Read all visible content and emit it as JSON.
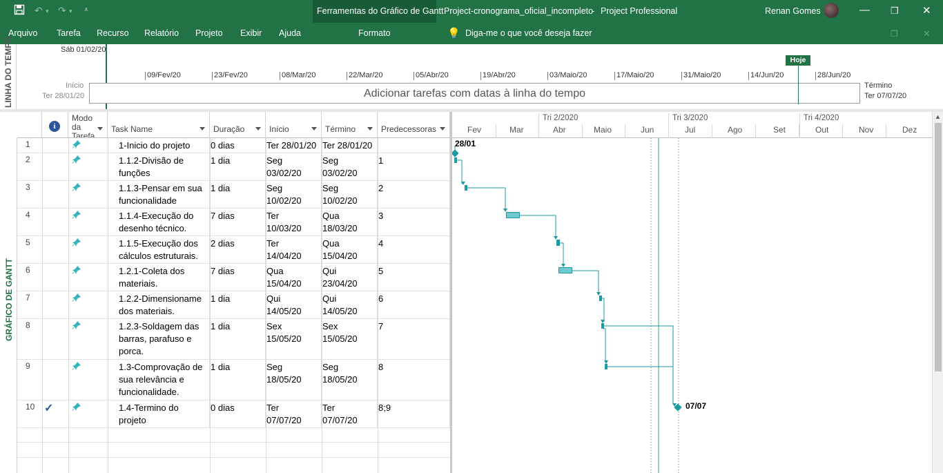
{
  "titlebar": {
    "context_tab": "Ferramentas do Gráfico de Gantt",
    "document_title": "Project-cronograma_oficial_incompleto",
    "separator": "-",
    "app_name": "Project Professional",
    "user_name": "Renan Gomes"
  },
  "ribbon": {
    "tabs": [
      "Arquivo",
      "Tarefa",
      "Recurso",
      "Relatório",
      "Projeto",
      "Exibir",
      "Ajuda"
    ],
    "format_tab": "Formato",
    "tell_me": "Diga-me o que você deseja fazer"
  },
  "timeline": {
    "side_label": "LINHA DO TEMPO",
    "top_date": "Sáb 01/02/20",
    "today_label": "Hoje",
    "dates": [
      "09/Fev/20",
      "23/Fev/20",
      "08/Mar/20",
      "22/Mar/20",
      "05/Abr/20",
      "19/Abr/20",
      "03/Maio/20",
      "17/Maio/20",
      "31/Maio/20",
      "14/Jun/20",
      "28/Jun/20"
    ],
    "start_label": "Início",
    "start_date": "Ter 28/01/20",
    "end_label": "Término",
    "end_date": "Ter 07/07/20",
    "placeholder": "Adicionar tarefas com datas à linha do tempo"
  },
  "grid": {
    "side_label": "GRÁFICO DE GANTT",
    "headers": {
      "info": "i",
      "mode": "Modo da Tarefa",
      "name": "Task Name",
      "duration": "Duração",
      "start": "Início",
      "finish": "Término",
      "predecessors": "Predecessoras"
    },
    "rows": [
      {
        "id": "1",
        "name": [
          "1-Inicio do projeto"
        ],
        "duration": "0 dias",
        "start": [
          "Ter 28/01/20"
        ],
        "finish": [
          "Ter 28/01/20"
        ],
        "pred": "",
        "check": false
      },
      {
        "id": "2",
        "name": [
          "1.1.2-Divisão de",
          "funções"
        ],
        "duration": "1 dia",
        "start": [
          "Seg",
          "03/02/20"
        ],
        "finish": [
          "Seg",
          "03/02/20"
        ],
        "pred": "1",
        "check": false
      },
      {
        "id": "3",
        "name": [
          "1.1.3-Pensar em sua",
          "funcionalidade"
        ],
        "duration": "1 dia",
        "start": [
          "Seg",
          "10/02/20"
        ],
        "finish": [
          "Seg",
          "10/02/20"
        ],
        "pred": "2",
        "check": false
      },
      {
        "id": "4",
        "name": [
          "1.1.4-Execução do",
          "desenho técnico."
        ],
        "duration": "7 dias",
        "start": [
          "Ter",
          "10/03/20"
        ],
        "finish": [
          "Qua",
          "18/03/20"
        ],
        "pred": "3",
        "check": false
      },
      {
        "id": "5",
        "name": [
          "1.1.5-Execução dos",
          "cálculos estruturais."
        ],
        "duration": "2 dias",
        "start": [
          "Ter",
          "14/04/20"
        ],
        "finish": [
          "Qua",
          "15/04/20"
        ],
        "pred": "4",
        "check": false
      },
      {
        "id": "6",
        "name": [
          "1.2.1-Coleta dos",
          "materiais."
        ],
        "duration": "7 dias",
        "start": [
          "Qua",
          "15/04/20"
        ],
        "finish": [
          "Qui",
          "23/04/20"
        ],
        "pred": "5",
        "check": false
      },
      {
        "id": "7",
        "name": [
          "1.2.2-Dimensioname",
          "dos materiais."
        ],
        "duration": "1 dia",
        "start": [
          "Qui",
          "14/05/20"
        ],
        "finish": [
          "Qui",
          "14/05/20"
        ],
        "pred": "6",
        "check": false
      },
      {
        "id": "8",
        "name": [
          "1.2.3-Soldagem das",
          "barras, parafuso e",
          "porca."
        ],
        "duration": "1 dia",
        "start": [
          "Sex",
          "15/05/20"
        ],
        "finish": [
          "Sex",
          "15/05/20"
        ],
        "pred": "7",
        "check": false
      },
      {
        "id": "9",
        "name": [
          "1.3-Comprovação de",
          "sua relevância e",
          "funcionalidade."
        ],
        "duration": "1 dia",
        "start": [
          "Seg",
          "18/05/20"
        ],
        "finish": [
          "Seg",
          "18/05/20"
        ],
        "pred": "8",
        "check": false
      },
      {
        "id": "10",
        "name": [
          "1.4-Termino do",
          "projeto"
        ],
        "duration": "0 dias",
        "start": [
          "Ter",
          "07/07/20"
        ],
        "finish": [
          "Ter",
          "07/07/20"
        ],
        "pred": "8;9",
        "check": true
      }
    ]
  },
  "gantt": {
    "quarters": [
      "Tri 2/2020",
      "Tri 3/2020",
      "Tri 4/2020"
    ],
    "months": [
      "Fev",
      "Mar",
      "Abr",
      "Maio",
      "Jun",
      "Jul",
      "Ago",
      "Set",
      "Out",
      "Nov",
      "Dez"
    ],
    "start_milestone_label": "28/01",
    "end_milestone_label": "07/07"
  },
  "colors": {
    "brand": "#217346",
    "bar": "#6fc8cf",
    "bar_border": "#1d9aa4"
  }
}
